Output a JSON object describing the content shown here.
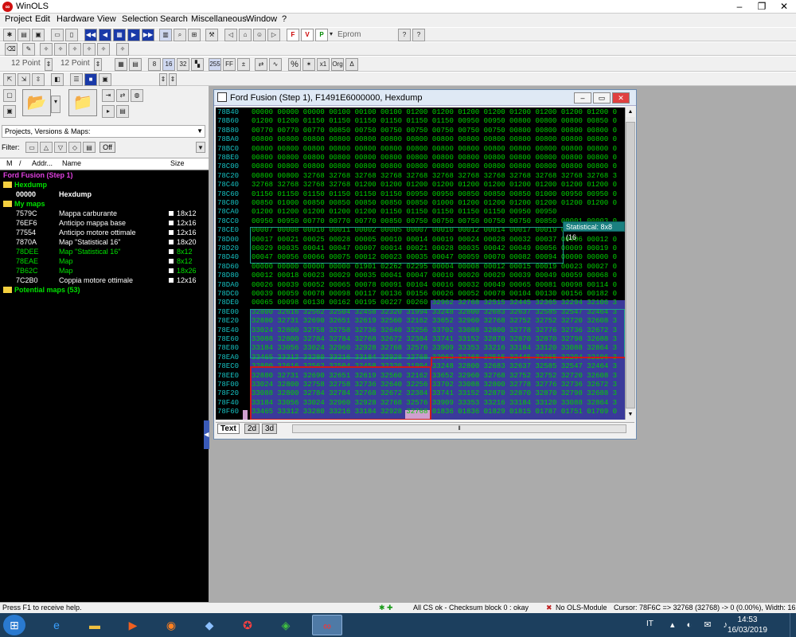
{
  "window": {
    "title": "WinOLS"
  },
  "menu": [
    "Project",
    "Edit",
    "Hardware",
    "View",
    "Selection",
    "Search",
    "Miscellaneous",
    "Window",
    "?"
  ],
  "toolbar": {
    "eprom": "Eprom",
    "point_a": "12 Point",
    "point_b": "12 Point",
    "btn_255": "255",
    "btn_ff": "FF",
    "btn_org": "Org",
    "btn_x1": "x1",
    "btn_pct": "%"
  },
  "left": {
    "combo": "Projects, Versions & Maps:",
    "filter": "Filter:",
    "off": "Off",
    "cols": {
      "m": "M",
      "sort": "/",
      "addr": "Addr...",
      "name": "Name",
      "size": "Size"
    },
    "project": "Ford Fusion (Step 1)",
    "hexdump_folder": "Hexdump",
    "hexdump_item": {
      "addr": "00000",
      "name": "Hexdump"
    },
    "mymaps_folder": "My maps",
    "maps": [
      {
        "addr": "7579C",
        "name": "Mappa carburante",
        "size": "18x12",
        "color": "#ffffff"
      },
      {
        "addr": "76EF6",
        "name": "Anticipo mappa base",
        "size": "12x16",
        "color": "#ffffff"
      },
      {
        "addr": "77554",
        "name": "Anticipo motore ottimale",
        "size": "12x16",
        "color": "#ffffff"
      },
      {
        "addr": "7870A",
        "name": "Map \"Statistical 16\"",
        "size": "18x20",
        "color": "#ffffff"
      },
      {
        "addr": "78DEE",
        "name": "Map \"Statistical 16\"",
        "size": "8x12",
        "color": "#00e000"
      },
      {
        "addr": "78EAE",
        "name": "Map",
        "size": "8x12",
        "color": "#00e000"
      },
      {
        "addr": "7B62C",
        "name": "Map",
        "size": "18x26",
        "color": "#00e000"
      },
      {
        "addr": "7C2B0",
        "name": "Coppia motore ottimale",
        "size": "12x16",
        "color": "#ffffff"
      }
    ],
    "potential": "Potential maps (53)"
  },
  "hexwin": {
    "title": "Ford Fusion (Step 1), F1491E6000000, Hexdump",
    "tooltip": "Statistical: 8x8 (16",
    "tabs": [
      "Text",
      "2d",
      "3d"
    ],
    "rows": [
      {
        "a": "78B40",
        "d": "00000 00000 00000 00100 00100 00100 01200 01200 01200 01200 01200 01200 01200 01200 0"
      },
      {
        "a": "78B60",
        "d": "01200 01200 01150 01150 01150 01150 01150 01150 00950 00950 00800 00800 00800 00850 0"
      },
      {
        "a": "78B80",
        "d": "00770 00770 00770 00850 00750 00750 00750 00750 00750 00750 00800 00800 00800 00800 0"
      },
      {
        "a": "78BA0",
        "d": "00800 00800 00800 00800 00800 00800 00800 00800 00800 00800 00800 00800 00800 00800 0"
      },
      {
        "a": "78BC0",
        "d": "00800 00800 00800 00800 00800 00800 00800 00800 00800 00800 00800 00800 00800 00800 0"
      },
      {
        "a": "78BE0",
        "d": "00800 00800 00800 00800 00800 00800 00800 00800 00800 00800 00800 00800 00800 00800 0"
      },
      {
        "a": "78C00",
        "d": "00800 00800 00800 00800 00800 00800 00800 00800 00800 00800 00800 00800 00800 00800 0"
      },
      {
        "a": "78C20",
        "d": "00800 00800 32768 32768 32768 32768 32768 32768 32768 32768 32768 32768 32768 32768 3"
      },
      {
        "a": "78C40",
        "d": "32768 32768 32768 32768 01200 01200 01200 01200 01200 01200 01200 01200 01200 01200 0"
      },
      {
        "a": "78C60",
        "d": "01150 01150 01150 01150 01150 01150 00950 00950 00850 00850 00850 01000 00950 00950 0"
      },
      {
        "a": "78C80",
        "d": "00850 01000 00850 00850 00850 00850 00850 01000 01200 01200 01200 01200 01200 01200 0"
      },
      {
        "a": "78CA0",
        "d": "01200 01200 01200 01200 01200 01150 01150 01150 01150 01150 00950 00950 "
      },
      {
        "a": "78CC0",
        "d": "00950 00950 00770 00770 00770 00850 00750 00750 00750 00750 00750 00850 00001 00003 0"
      },
      {
        "a": "78CE0",
        "d": "00007 00008 00010 00011 00002 00005 00007 00010 00012 00014 00017 00019 00004 00007 0"
      },
      {
        "a": "78D00",
        "d": "00017 00021 00025 00028 00005 00010 00014 00019 00024 00028 00032 00037 00006 00012 0"
      },
      {
        "a": "78D20",
        "d": "00029 00035 00041 00047 00007 00014 00021 00028 00035 00042 00049 00056 00009 00019 0"
      },
      {
        "a": "78D40",
        "d": "00047 00056 00066 00075 00012 00023 00035 00047 00059 00070 00082 00094 00000 00000 0"
      },
      {
        "a": "78D60",
        "d": "00000 00000 00000 00000 01901 02262 02295 00004 00008 00012 00015 00019 00023 00027 0"
      },
      {
        "a": "78D80",
        "d": "00012 00018 00023 00029 00035 00041 00047 00010 00020 00029 00039 00049 00059 00068 0"
      },
      {
        "a": "78DA0",
        "d": "00026 00039 00052 00065 00078 00091 00104 00016 00032 00049 00065 00081 00098 00114 0"
      },
      {
        "a": "78DC0",
        "d": "00039 00059 00078 00098 00117 00136 00156 00026 00052 00078 00104 00130 00156 00182 0"
      },
      {
        "a": "78DE0",
        "d": "00065 00098 00130 00162 00195 00227 00260 32962 32768 32515 32445 32365 32294 32106 3"
      },
      {
        "a": "78E00",
        "d": "32800 32616 32562 32504 32458 32320 31994 33248 32800 32683 32637 32585 32547 32464 3"
      },
      {
        "a": "78E20",
        "d": "32880 32731 32690 32651 32619 32560 32162 33652 32960 32768 32752 32752 32720 32608 3"
      },
      {
        "a": "78E40",
        "d": "33024 32800 32758 32758 32736 32640 32256 33702 33088 32800 32778 32776 32736 32672 3"
      },
      {
        "a": "78E60",
        "d": "33088 32800 32784 32784 32768 32672 32384 33741 33152 32870 32870 32870 32798 32688 3"
      },
      {
        "a": "78E80",
        "d": "33184 33056 33024 32960 32928 32768 32576 33909 33353 33216 33184 33120 33088 32864 3"
      },
      {
        "a": "78EA0",
        "d": "33465 33312 33280 33216 33184 32928 32768 32962 32768 32515 32445 32365 32294 32106 3"
      },
      {
        "a": "78EC0",
        "d": "32800 32616 32562 32504 32458 32320 31994 33248 32800 32683 32637 32585 32547 32464 3"
      },
      {
        "a": "78EE0",
        "d": "32880 32731 32690 32651 32619 32560 32162 33652 32960 32768 32752 32752 32720 32608 3"
      },
      {
        "a": "78F00",
        "d": "33024 32800 32758 32758 32736 32640 32256 33702 33088 32800 32778 32776 32736 32672 3"
      },
      {
        "a": "78F20",
        "d": "33088 32800 32784 32784 32768 32672 32384 33741 33152 32870 32870 32870 32798 32688 3"
      },
      {
        "a": "78F40",
        "d": "33184 33056 33024 32960 32928 32768 32576 33909 33353 33216 33184 33120 33088 32864 3"
      },
      {
        "a": "78F60",
        "d": "33465 33312 33280 33216 33184 32928 32768 01836 01836 01829 01815 01787 01751 01709 0"
      }
    ]
  },
  "status": {
    "help": "Press F1 to receive help.",
    "checksum": "All CS ok - Checksum block 0 : okay",
    "module": "No OLS-Module",
    "cursor": "Cursor: 78F6C => 32768 (32768) -> 0 (0.00%), Width: 16"
  },
  "taskbar": {
    "lang": "IT",
    "time": "14:53",
    "date": "16/03/2019"
  }
}
